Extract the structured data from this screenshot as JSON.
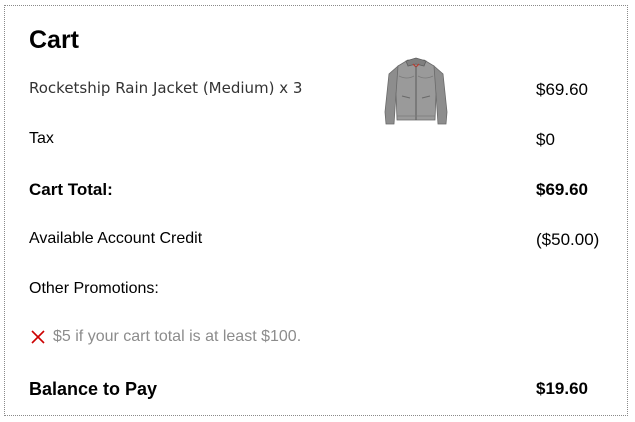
{
  "cart": {
    "title": "Cart",
    "item": {
      "label": "Rocketship Rain Jacket (Medium) x 3",
      "price": "$69.60",
      "image": "jacket-image"
    },
    "tax": {
      "label": "Tax",
      "value": "$0"
    },
    "total": {
      "label": "Cart Total:",
      "value": "$69.60"
    },
    "credit": {
      "label": "Available Account Credit",
      "value": "($50.00)"
    },
    "promotions": {
      "label": "Other Promotions:",
      "items": [
        {
          "icon": "x-icon",
          "icon_color": "#cc0000",
          "text": "$5 if your cart total is at least $100."
        }
      ]
    },
    "balance": {
      "label": "Balance to Pay",
      "value": "$19.60"
    }
  }
}
